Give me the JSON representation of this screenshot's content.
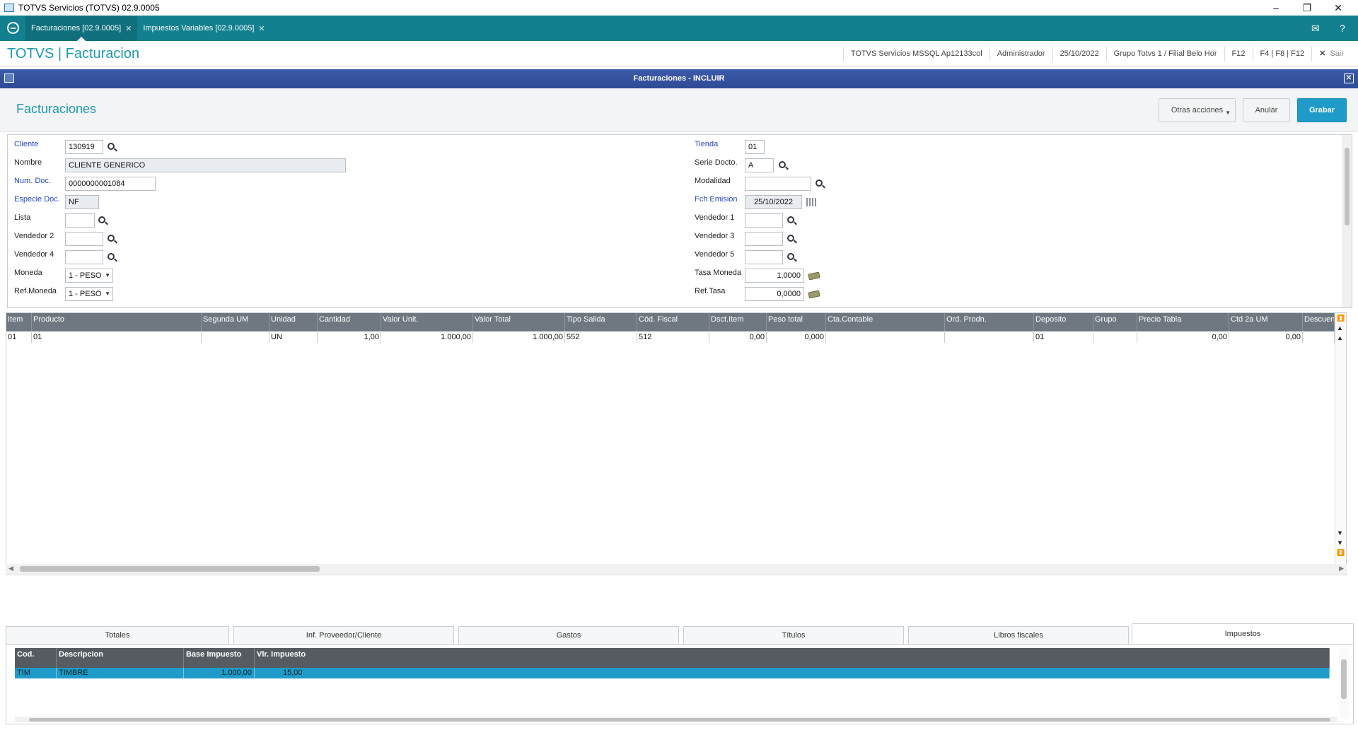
{
  "window": {
    "title": "TOTVS Servicios (TOTVS) 02.9.0005"
  },
  "tabs": [
    {
      "label": "Facturaciones [02.9.0005]"
    },
    {
      "label": "Impuestos Variables [02.9.0005]"
    }
  ],
  "header": {
    "brand": "TOTVS | Facturacion",
    "info": [
      "TOTVS Servicios MSSQL Ap12133col",
      "Administrador",
      "25/10/2022",
      "Grupo Totvs 1 / Filial Belo Hor",
      "F12",
      "F4 | F8 | F12"
    ],
    "exit_label": "Sair"
  },
  "dialog": {
    "title": "Facturaciones - INCLUIR",
    "page_title": "Facturaciones",
    "buttons": {
      "other_actions": "Otras acciones",
      "cancel": "Anular",
      "save": "Grabar"
    }
  },
  "form": {
    "left": {
      "cliente": {
        "label": "Cliente",
        "value": "130919"
      },
      "nombre": {
        "label": "Nombre",
        "value": "CLIENTE GENERICO"
      },
      "num_doc": {
        "label": "Num. Doc.",
        "value": "0000000001084"
      },
      "especie_doc": {
        "label": "Especie Doc.",
        "value": "NF"
      },
      "lista": {
        "label": "Lista",
        "value": ""
      },
      "vendedor2": {
        "label": "Vendedor 2",
        "value": ""
      },
      "vendedor4": {
        "label": "Vendedor 4",
        "value": ""
      },
      "moneda": {
        "label": "Moneda",
        "value": "1 - PESO"
      },
      "ref_moneda": {
        "label": "Ref.Moneda",
        "value": "1 - PESO"
      }
    },
    "right": {
      "tienda": {
        "label": "Tienda",
        "value": "01"
      },
      "serie_docto": {
        "label": "Serie Docto.",
        "value": "A"
      },
      "modalidad": {
        "label": "Modalidad",
        "value": ""
      },
      "fch_emision": {
        "label": "Fch Emision",
        "value": "25/10/2022"
      },
      "vendedor1": {
        "label": "Vendedor 1",
        "value": ""
      },
      "vendedor3": {
        "label": "Vendedor 3",
        "value": ""
      },
      "vendedor5": {
        "label": "Vendedor 5",
        "value": ""
      },
      "tasa_moneda": {
        "label": "Tasa Moneda",
        "value": "1,0000"
      },
      "ref_tasa": {
        "label": "Ref.Tasa",
        "value": "0,0000"
      }
    }
  },
  "grid": {
    "columns": [
      "Item",
      "Producto",
      "Segunda UM",
      "Unidad",
      "Cantidad",
      "Valor Unit.",
      "Valor Total",
      "Tipo Salida",
      "Cód. Fiscal",
      "Dsct.Item",
      "Peso total",
      "Cta.Contable",
      "Ord. Prodn.",
      "Deposito",
      "Grupo",
      "Precio Tabla",
      "Ctd 2a UM",
      "Descuent"
    ],
    "rows": [
      [
        "01",
        "01",
        "",
        "UN",
        "1,00",
        "1.000,00",
        "1.000,00",
        "552",
        "512",
        "0,00",
        "0,000",
        "",
        "",
        "01",
        "",
        "0,00",
        "0,00",
        ""
      ]
    ]
  },
  "bottom_tabs": [
    "Totales",
    "Inf. Proveedor/Cliente",
    "Gastos",
    "Títulos",
    "Libros fiscales",
    "Impuestos"
  ],
  "taxes": {
    "columns": [
      "Cod.",
      "Descripcion",
      "Base Impuesto",
      "Vlr. Impuesto"
    ],
    "rows": [
      [
        "TIM",
        "TIMBRE",
        "1.000,00",
        "15,00"
      ]
    ]
  },
  "colors": {
    "accent": "#13808f",
    "brand": "#1d9ab0",
    "dialog_bar": "#2f4a95",
    "primary_button": "#1f9bc9",
    "required_label": "#2146c7"
  }
}
